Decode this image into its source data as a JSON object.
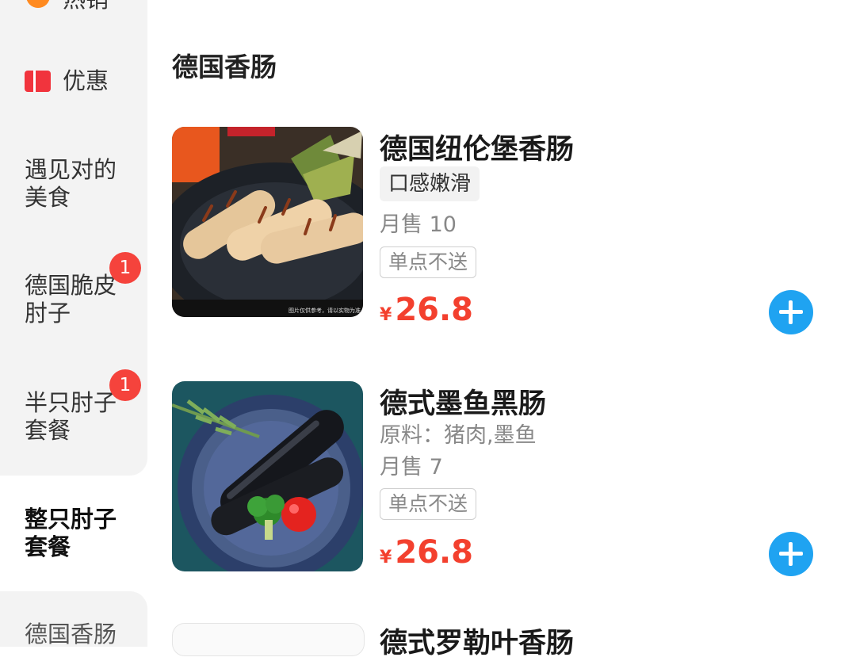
{
  "sidebar": {
    "items": [
      {
        "label": "热销"
      },
      {
        "label": "优惠"
      },
      {
        "label": "遇见对的美食"
      },
      {
        "label": "德国脆皮肘子",
        "badge": "1"
      },
      {
        "label": "半只肘子套餐",
        "badge": "1"
      },
      {
        "label": "整只肘子套餐",
        "active": true
      },
      {
        "label": "德国香肠"
      }
    ]
  },
  "section": {
    "title": "德国香肠"
  },
  "products": [
    {
      "name": "德国纽伦堡香肠",
      "tag": "口感嫩滑",
      "monthly_sales": "月售 10",
      "note": "单点不送",
      "currency": "¥",
      "price": "26.8",
      "image_caption": "图片仅供参考，请以实物为准"
    },
    {
      "name": "德式墨鱼黑肠",
      "ingredients": "原料：猪肉,墨鱼",
      "monthly_sales": "月售 7",
      "note": "单点不送",
      "currency": "¥",
      "price": "26.8"
    },
    {
      "name": "德式罗勒叶香肠"
    }
  ],
  "colors": {
    "price": "#f3402e",
    "add_button": "#1fa3f1",
    "badge": "#f5433c",
    "coupon_icon": "#f1343d",
    "sidebar_bg": "#f3f3f3"
  }
}
